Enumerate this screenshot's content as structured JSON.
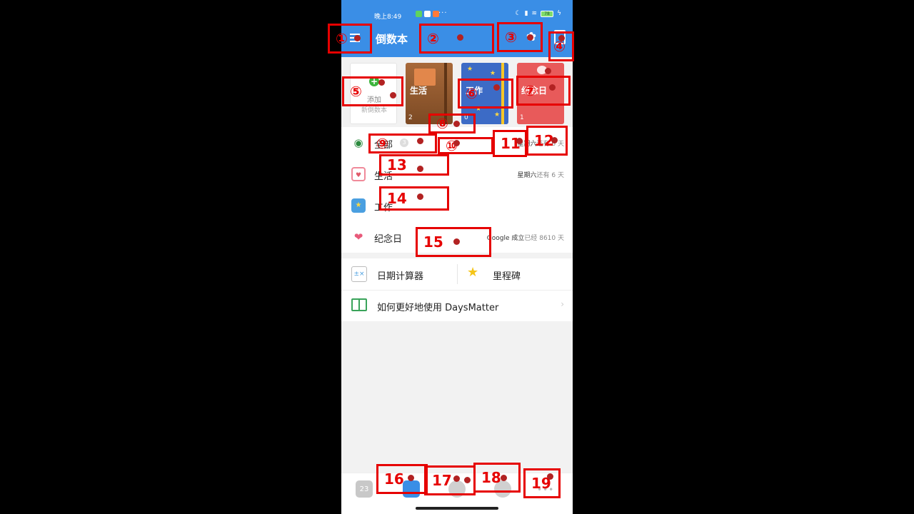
{
  "status_bar": {
    "time": "晚上8:49",
    "dots": "···",
    "battery": "78"
  },
  "header": {
    "title": "倒数本"
  },
  "notebooks": [
    {
      "label": "添加",
      "sublabel": "新倒数本"
    },
    {
      "label": "生活",
      "count": "2"
    },
    {
      "label": "工作",
      "count": "0"
    },
    {
      "label": "纪念日",
      "count": "1"
    }
  ],
  "categories": [
    {
      "name": "全部",
      "count": "3",
      "summary_event": "星期六",
      "summary_text": "还有 6 天"
    },
    {
      "name": "生活",
      "count": "",
      "summary_event": "星期六",
      "summary_text": "还有 6 天"
    },
    {
      "name": "工作",
      "count": "",
      "summary_event": "",
      "summary_text": ""
    },
    {
      "name": "纪念日",
      "count": "",
      "summary_event": "Google 成立",
      "summary_text": "已经 8610 天"
    }
  ],
  "tools": {
    "date_calc": "日期计算器",
    "milestone": "里程碑",
    "help": "如何更好地使用 DaysMatter"
  },
  "bottom_nav": {
    "calendar_day": "23"
  },
  "annotations": [
    "①",
    "②",
    "③",
    "④",
    "⑤",
    "⑥",
    "⑦",
    "⑧",
    "⑨",
    "⑩",
    "11",
    "12",
    "13",
    "14",
    "15",
    "16",
    "17",
    "18",
    "19"
  ]
}
